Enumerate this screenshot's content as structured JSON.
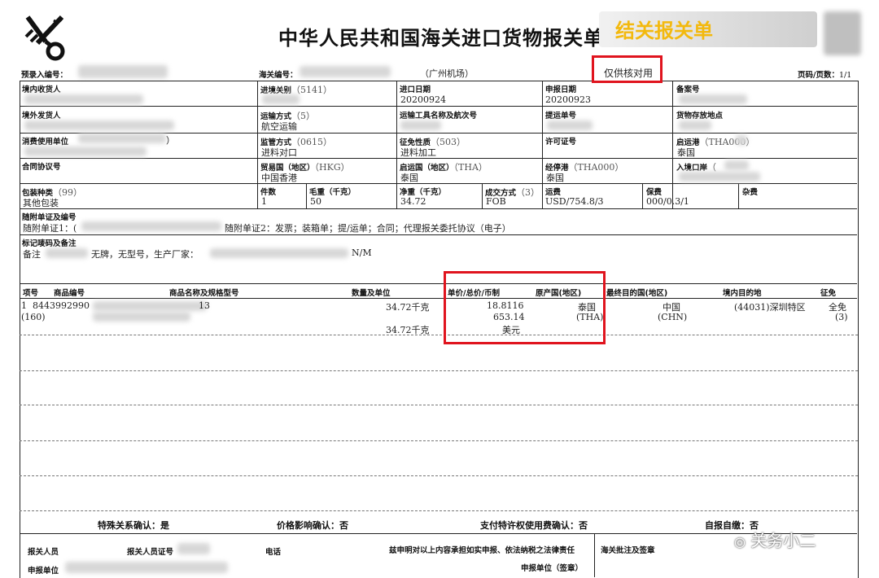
{
  "header": {
    "title": "中华人民共和国海关进口货物报关单",
    "badge": "结关报关单",
    "preentry_label": "预录入编号：",
    "customs_no_label": "海关编号：",
    "port_name": "（广州机场）",
    "verify_note": "仅供核对用",
    "page_label": "页码/页数：",
    "page_value": "1/1"
  },
  "row1": {
    "consignee_label": "境内收货人",
    "entry_port_label": "进境关别",
    "entry_port_value": "（5141）",
    "import_date_label": "进口日期",
    "import_date_value": "20200924",
    "declare_date_label": "申报日期",
    "declare_date_value": "20200923",
    "record_no_label": "备案号"
  },
  "row2": {
    "shipper_label": "境外发货人",
    "transport_label": "运输方式",
    "transport_code": "（5）",
    "transport_value": "航空运输",
    "vehicle_label": "运输工具名称及航次号",
    "bill_label": "提运单号",
    "storage_label": "货物存放地点"
  },
  "row3": {
    "consumer_label": "消费使用单位",
    "consumer_suffix": "）",
    "supervision_label": "监管方式",
    "supervision_code": "（0615）",
    "supervision_value": "进料对口",
    "levy_label": "征免性质",
    "levy_code": "（503）",
    "levy_value": "进料加工",
    "license_label": "许可证号",
    "depart_port_label": "启运港",
    "depart_port_code": "（THA000）",
    "depart_port_value": "泰国"
  },
  "row4": {
    "contract_label": "合同协议号",
    "trade_country_label": "贸易国（地区）",
    "trade_country_code": "（HKG）",
    "trade_country_value": "中国香港",
    "origin_country_label": "启运国（地区）",
    "origin_country_code": "（THA）",
    "origin_country_value": "泰国",
    "via_port_label": "经停港",
    "via_port_code": "（THA000）",
    "via_port_value": "泰国",
    "entry_place_label": "入境口岸",
    "entry_place_code": "（"
  },
  "row5": {
    "package_label": "包装种类",
    "package_code": "（99）",
    "package_value": "其他包装",
    "pieces_label": "件数",
    "pieces_value": "1",
    "gross_label": "毛重（千克）",
    "gross_value": "50",
    "net_label": "净重（千克）",
    "net_value": "34.72",
    "terms_label": "成交方式",
    "terms_code": "（3）",
    "terms_value": "FOB",
    "freight_label": "运费",
    "freight_value": "USD/754.8/3",
    "insurance_label": "保费",
    "insurance_value": "000/0.3/1",
    "misc_label": "杂费"
  },
  "docs": {
    "label": "随附单证及编号",
    "doc1_prefix": "随附单证1：(",
    "doc2": "随附单证2：发票；装箱单；提/运单；合同；代理报关委托协议（电子）"
  },
  "marks": {
    "label": "标记唛码及备注",
    "remark_label": "备注",
    "remark_text": "无牌，无型号，生产厂家：",
    "remark_end": "N/M"
  },
  "goods_table": {
    "headers": [
      "项号",
      "商品编号",
      "商品名称及规格型号",
      "数量及单位",
      "单价/总价/币制",
      "原产国(地区)",
      "最终目的国(地区)",
      "境内目的地",
      "征免"
    ],
    "item": {
      "no": "1",
      "code": "8443992990",
      "spec_tail": "13",
      "sub_no": "(160)",
      "qty1": "34.72千克",
      "qty2": "34.72千克",
      "unit_price": "18.8116",
      "total_price": "653.14",
      "currency": "美元",
      "origin": "泰国",
      "origin_code": "(THA)",
      "dest_country": "中国",
      "dest_code": "(CHN)",
      "domestic_dest": "(44031)深圳特区",
      "levy": "全免",
      "levy_code": "(3)"
    }
  },
  "confirm": {
    "special_rel": "特殊关系确认：是",
    "price_effect": "价格影响确认：否",
    "royalty": "支付特许权使用费确认：否",
    "self_pay": "自报自缴：否"
  },
  "footer": {
    "declarant_label": "报关人员",
    "declarant_cert_label": "报关人员证号",
    "phone_label": "电话",
    "statement": "兹申明对以上内容承担如实申报、依法纳税之法律责任",
    "unit_label": "申报单位",
    "unit_seal_label": "申报单位（签章）",
    "customs_note_label": "海关批注及签章"
  },
  "watermark": {
    "text": "关务小二"
  }
}
